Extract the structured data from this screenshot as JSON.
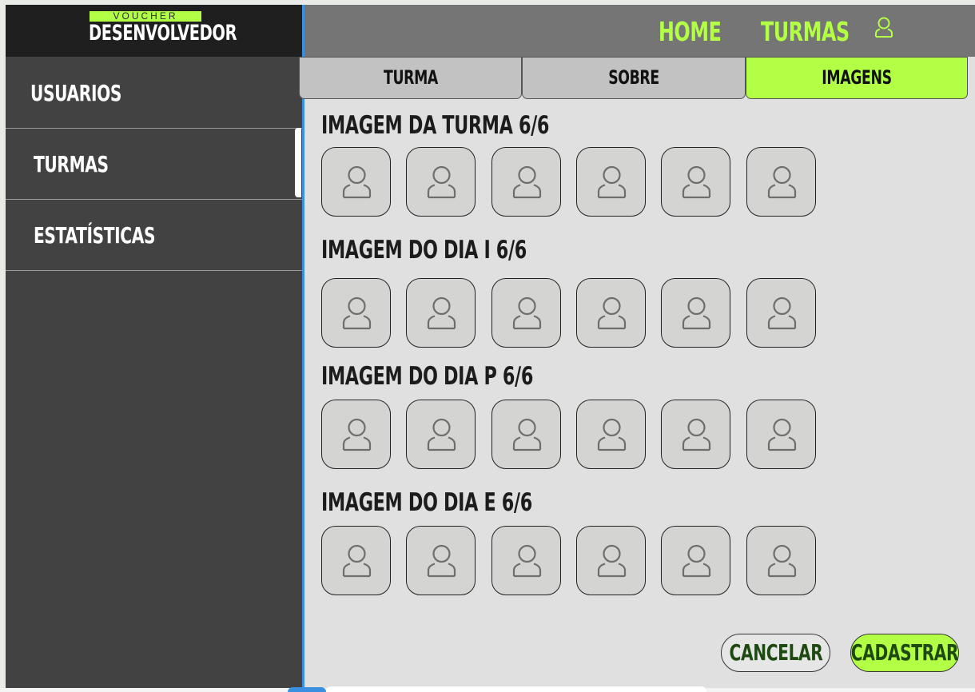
{
  "logo": {
    "top": "VOUCHER",
    "bottom": "DESENVOLVEDOR"
  },
  "sidebar": {
    "items": [
      {
        "label": "USUARIOS"
      },
      {
        "label": "TURMAS"
      },
      {
        "label": "ESTATÍSTICAS"
      }
    ],
    "active_index": 1
  },
  "header": {
    "nav": [
      {
        "label": "HOME"
      },
      {
        "label": "TURMAS"
      }
    ],
    "user_icon": "user-icon"
  },
  "tabs": [
    {
      "label": "TURMA",
      "active": false
    },
    {
      "label": "SOBRE",
      "active": false
    },
    {
      "label": "IMAGENS",
      "active": true
    }
  ],
  "sections": [
    {
      "title": "IMAGEM DA TURMA 6/6",
      "slots": 6
    },
    {
      "title": "IMAGEM DO DIA I  6/6",
      "slots": 6
    },
    {
      "title": "IMAGEM DO DIA P  6/6",
      "slots": 6
    },
    {
      "title": "IMAGEM DO DIA E  6/6",
      "slots": 6
    }
  ],
  "actions": {
    "cancel": "CANCELAR",
    "submit": "CADASTRAR"
  },
  "colors": {
    "accent": "#b3ff46",
    "sidebar": "#424242",
    "header": "#757575",
    "main": "#e0e0e0"
  }
}
